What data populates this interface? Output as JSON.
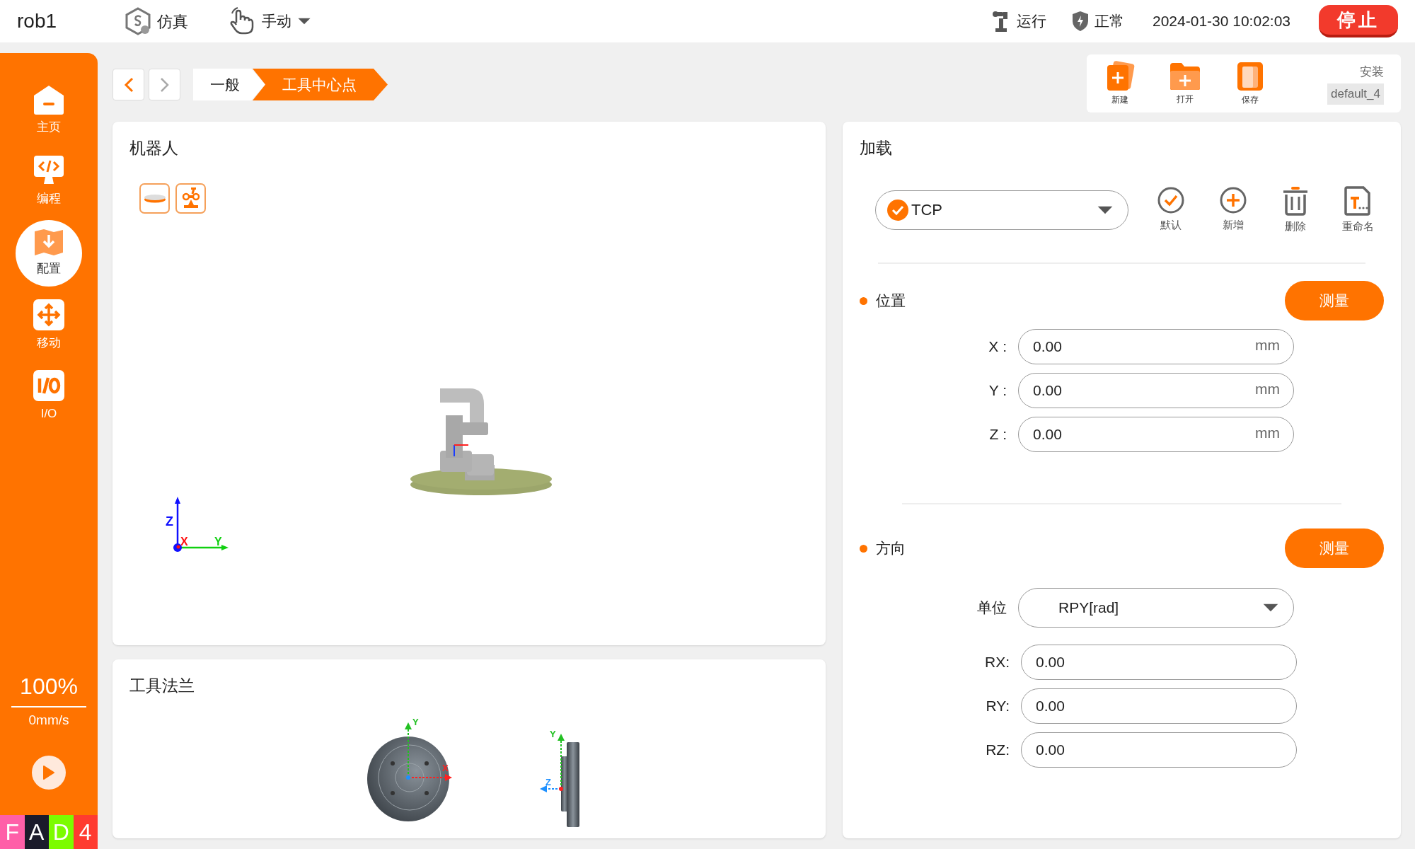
{
  "top_bar": {
    "robot": "rob1",
    "mode": "仿真",
    "control": "手动",
    "run_state": "运行",
    "safety": "正常",
    "datetime": "2024-01-30 10:02:03",
    "stop_button": "停止"
  },
  "sidebar": {
    "items": [
      {
        "label": "主页",
        "kind": "home",
        "selected": false
      },
      {
        "label": "编程",
        "kind": "code",
        "selected": false
      },
      {
        "label": "配置",
        "kind": "config",
        "selected": true
      },
      {
        "label": "移动",
        "kind": "move",
        "selected": false
      },
      {
        "label": "I/O",
        "kind": "io",
        "selected": false
      }
    ],
    "speed": "100%",
    "velocity": "0mm/s",
    "status_letters": [
      {
        "text": "F",
        "color": "#ff5fa8"
      },
      {
        "text": "A",
        "color": "#1b1b2b"
      },
      {
        "text": "D",
        "color": "#7cfc00"
      },
      {
        "text": "4",
        "color": "#ff3b30"
      }
    ]
  },
  "breadcrumb": {
    "items": [
      {
        "label": "一般",
        "selected": false
      },
      {
        "label": "工具中心点",
        "selected": true
      }
    ]
  },
  "file_toolbar": {
    "actions": [
      {
        "label": "新建",
        "kind": "new"
      },
      {
        "label": "打开",
        "kind": "open"
      },
      {
        "label": "保存",
        "kind": "save"
      }
    ],
    "install_label": "安装",
    "install_name": "default_4"
  },
  "robot_panel": {
    "title": "机器人",
    "axis_labels": {
      "z": "Z",
      "x": "X",
      "y": "Y"
    }
  },
  "flange_panel": {
    "title": "工具法兰",
    "front_axes": {
      "y": "Y",
      "x": "X"
    },
    "side_axes": {
      "y": "Y",
      "z": "Z"
    }
  },
  "payload_panel": {
    "title": "加载",
    "tcp": "TCP",
    "actions": [
      {
        "label": "默认",
        "kind": "default"
      },
      {
        "label": "新增",
        "kind": "add"
      },
      {
        "label": "删除",
        "kind": "delete"
      },
      {
        "label": "重命名",
        "kind": "rename"
      }
    ],
    "position": {
      "title": "位置",
      "measure": "测量",
      "fields": [
        {
          "label": "X :",
          "value": "0.00",
          "unit": "mm"
        },
        {
          "label": "Y :",
          "value": "0.00",
          "unit": "mm"
        },
        {
          "label": "Z :",
          "value": "0.00",
          "unit": "mm"
        }
      ]
    },
    "orientation": {
      "title": "方向",
      "measure": "测量",
      "unit_label": "单位",
      "unit_value": "RPY[rad]",
      "fields": [
        {
          "label": "RX:",
          "value": "0.00"
        },
        {
          "label": "RY:",
          "value": "0.00"
        },
        {
          "label": "RZ:",
          "value": "0.00"
        }
      ]
    }
  }
}
